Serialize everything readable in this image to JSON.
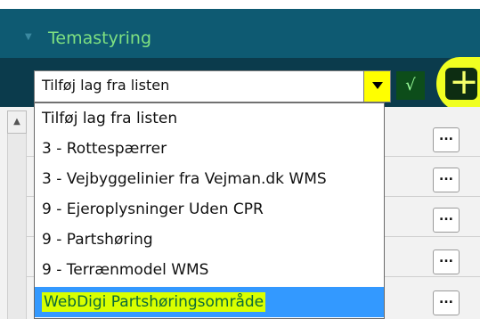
{
  "panel": {
    "title": "Temastyring",
    "collapse_icon": "chevron-down-icon"
  },
  "toolbar": {
    "select_value": "Tilføj lag fra listen",
    "check_icon": "checkmark-icon",
    "check_label": "√",
    "add_icon": "plus-icon",
    "add_label": "+"
  },
  "dropdown": {
    "options": [
      "Tilføj lag fra listen",
      "3 - Rottespærrer",
      "3 - Vejbyggelinier fra Vejman.dk WMS",
      "9 - Ejeroplysninger Uden CPR",
      "9 - Partshøring",
      "9 - Terrænmodel WMS",
      "WebDigi Partshøringsområde"
    ],
    "selected_index": 6
  },
  "list": {
    "more_label": "...",
    "scroll_up_label": "^"
  },
  "colors": {
    "header_bg": "#0e5a72",
    "toolbar_bg": "#0b3b4c",
    "title_green": "#7ee081",
    "highlight_yellow": "#f0ff21",
    "selected_blue": "#3399ff"
  }
}
